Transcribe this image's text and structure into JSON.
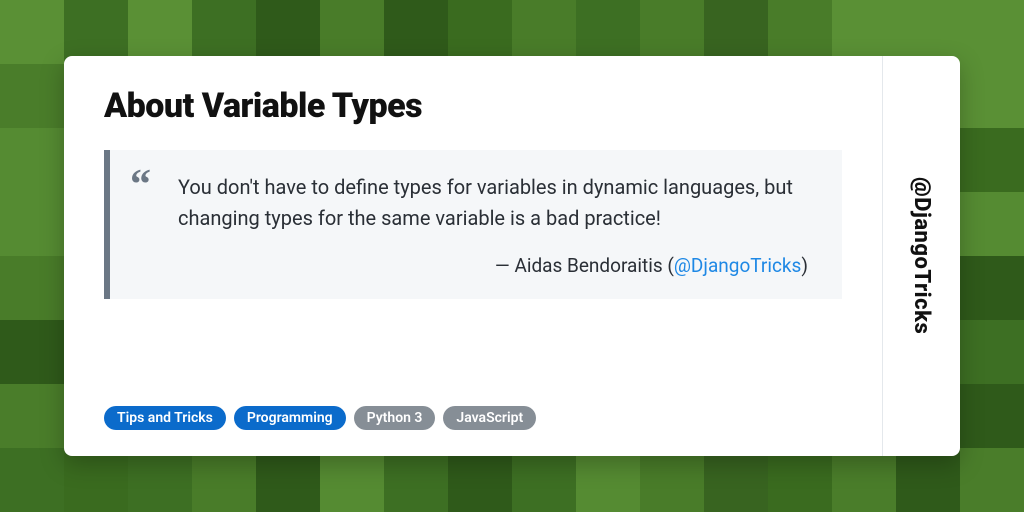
{
  "title": "About Variable Types",
  "quote": "You don't have to define types for variables in dynamic languages, but changing types for the same variable is a bad practice!",
  "attribution_prefix": "— Aidas Bendoraitis (",
  "attribution_handle": "@DjangoTricks",
  "attribution_suffix": ")",
  "sidebar_handle": "@DjangoTricks",
  "tags": [
    {
      "label": "Tips and Tricks",
      "variant": "primary"
    },
    {
      "label": "Programming",
      "variant": "primary"
    },
    {
      "label": "Python 3",
      "variant": "secondary"
    },
    {
      "label": "JavaScript",
      "variant": "secondary"
    }
  ],
  "bg_palette": [
    "#3a6b1f",
    "#4a7d2a",
    "#386420",
    "#558b32",
    "#2f5a1a",
    "#497c29",
    "#3d6f23",
    "#5a9035"
  ]
}
